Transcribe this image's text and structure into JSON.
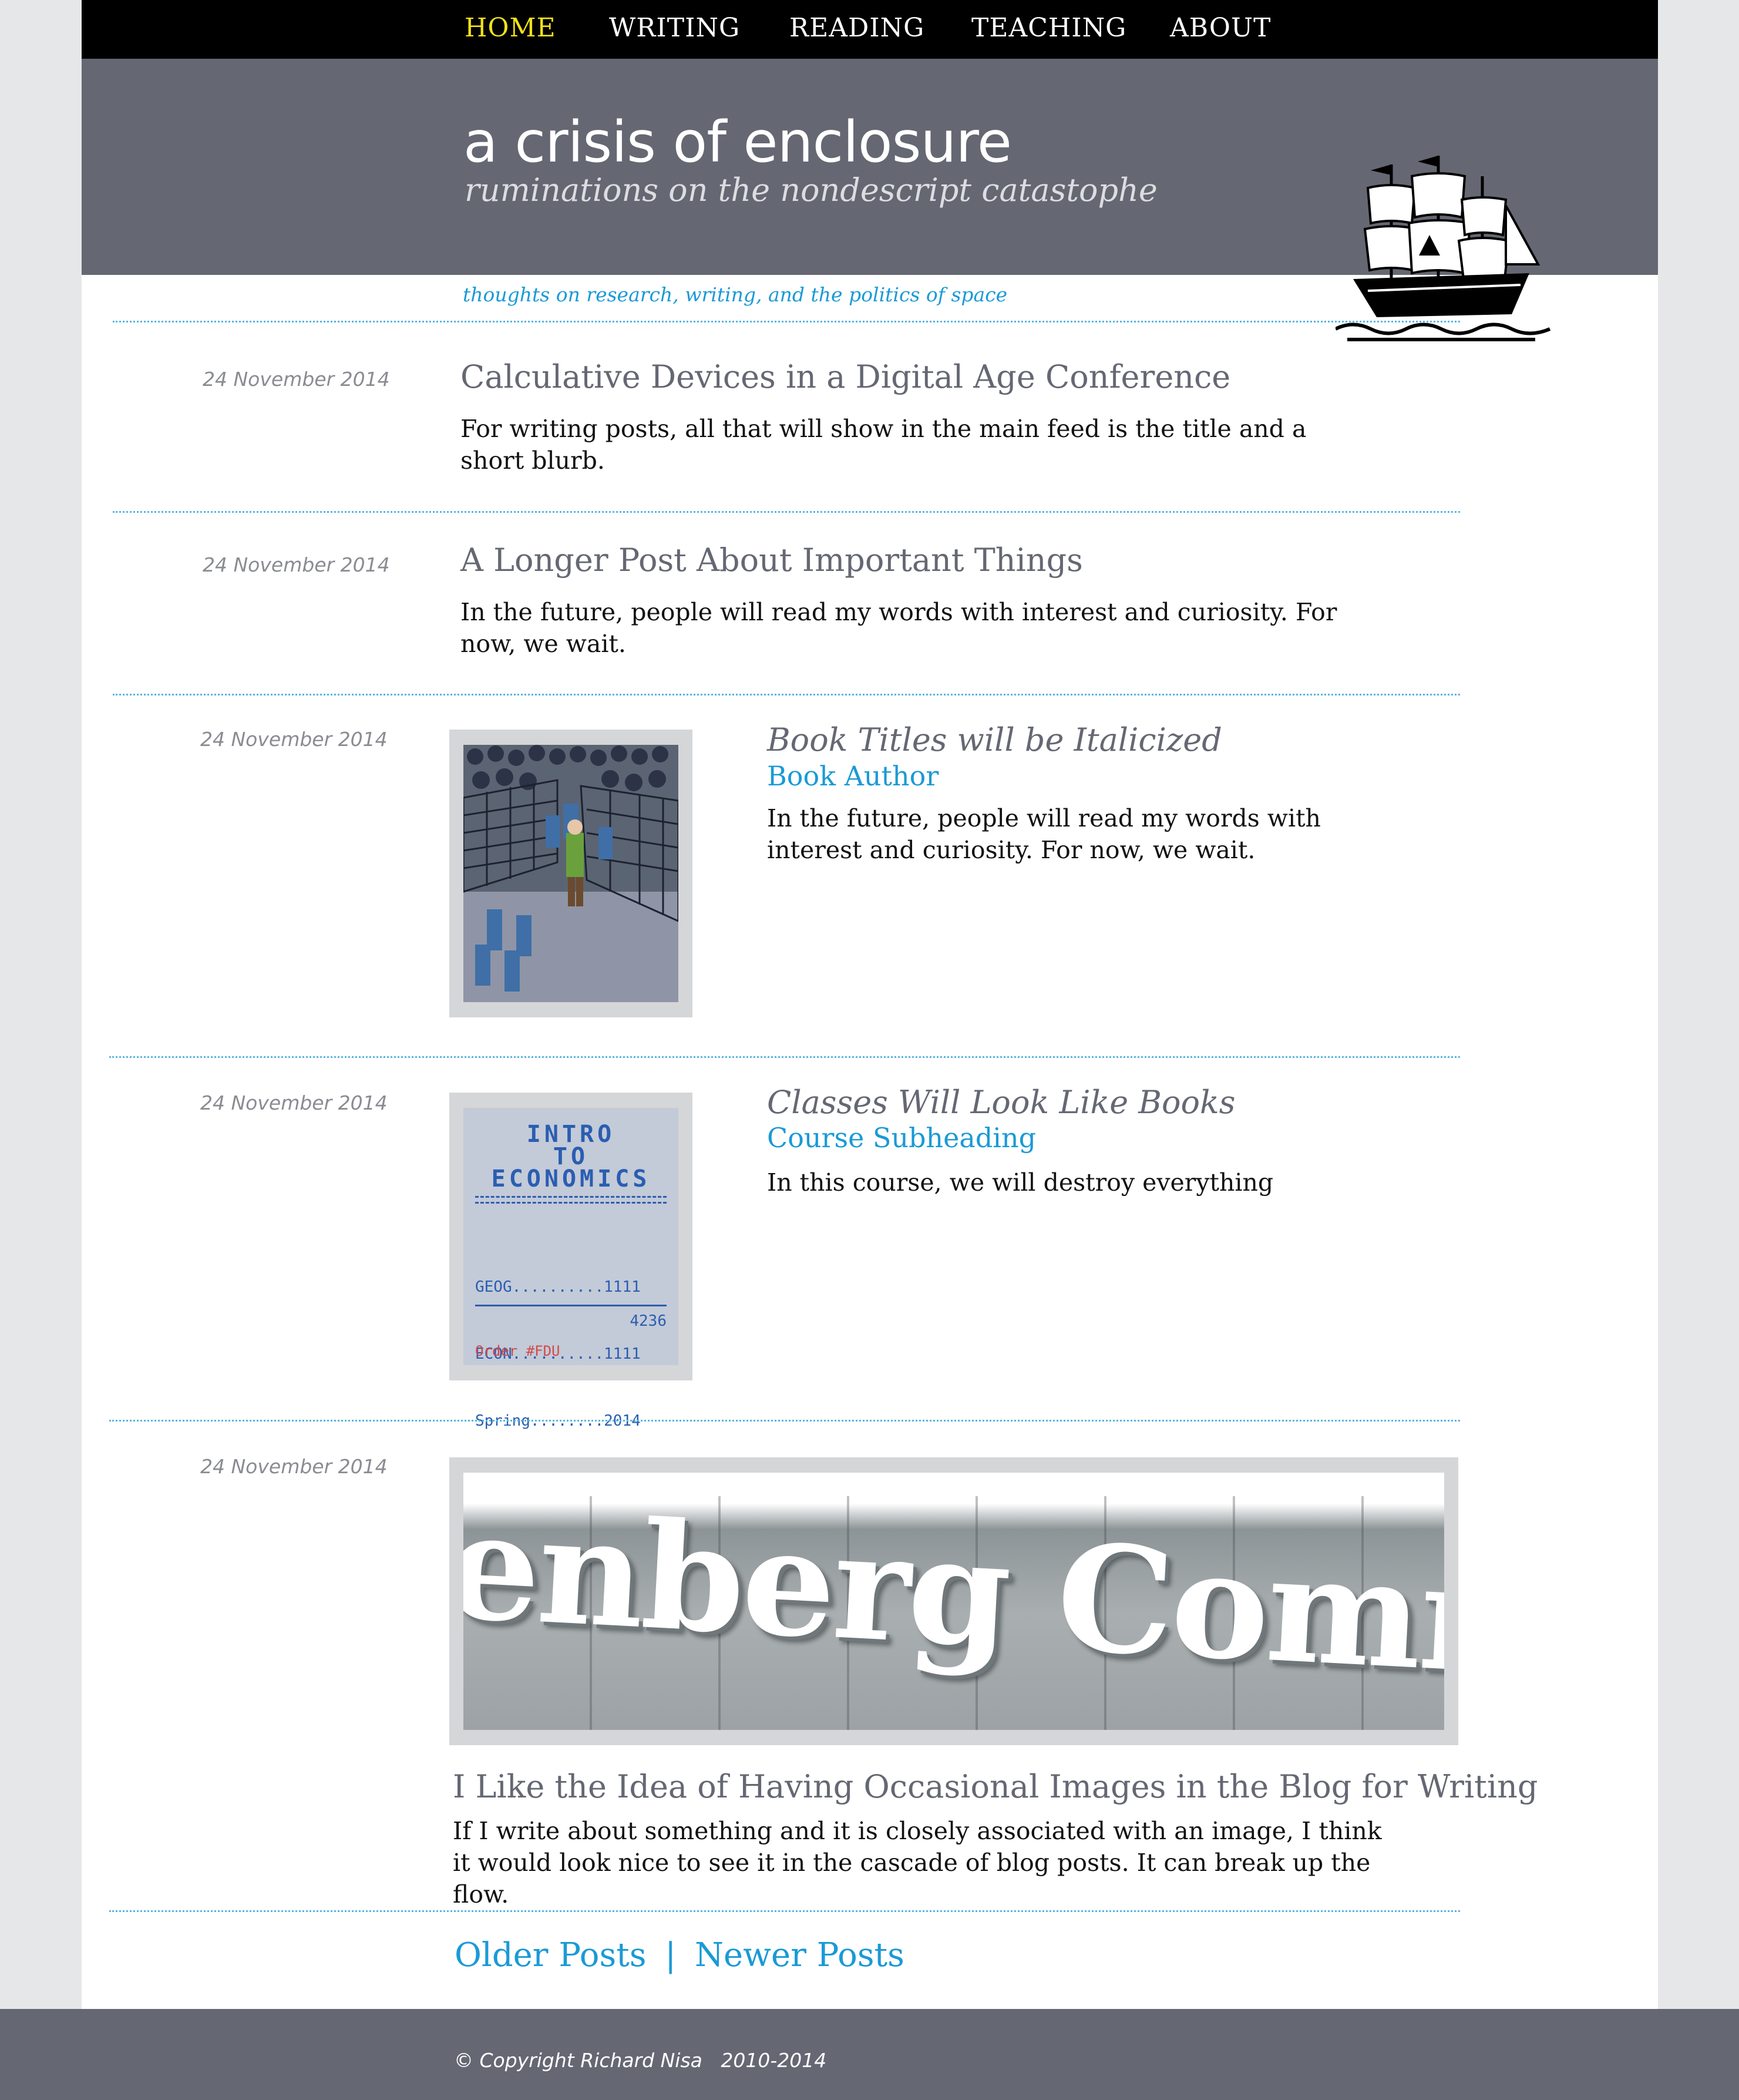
{
  "nav": {
    "items": [
      {
        "label": "HOME",
        "active": true
      },
      {
        "label": "WRITING",
        "active": false
      },
      {
        "label": "READING",
        "active": false
      },
      {
        "label": "TEACHING",
        "active": false
      },
      {
        "label": "ABOUT",
        "active": false
      }
    ]
  },
  "header": {
    "title": "a crisis of enclosure",
    "subtitle": "ruminations on the nondescript catastophe",
    "logo_icon": "ship-icon",
    "tagline": "thoughts on research, writing, and the politics of space"
  },
  "posts": [
    {
      "date": "24 November 2014",
      "title": "Calculative Devices in a Digital Age Conference",
      "body": "For writing posts, all that will show in the main feed is the title and a short blurb."
    },
    {
      "date": "24 November 2014",
      "title": "A Longer Post About Important Things",
      "body": "In the future, people will read my words with interest and curiosity. For now, we wait."
    },
    {
      "date": "24 November 2014",
      "title": "Book Titles will be Italicized",
      "subheading": "Book Author",
      "body": "In the future, people will read my words with interest and curiosity. For now, we wait."
    },
    {
      "date": "24 November 2014",
      "title": "Classes Will Look Like Books",
      "subheading": "Course Subheading",
      "body": "In this course, we will destroy everything",
      "cover": {
        "line1": "INTRO",
        "line2": "TO",
        "line3": "ECONOMICS",
        "rows": [
          "GEOG..........1111",
          "ECON..........1111",
          "Spring........2014"
        ],
        "number": "4236",
        "order": "Order #FDU"
      }
    },
    {
      "date": "24 November 2014",
      "title": "I Like the Idea of Having Occasional Images in the Blog for Writing",
      "body": "If I write about something and it is closely associated with an image, I think it would look nice to see it in the cascade of blog posts. It can break up the flow.",
      "banner_text": "enberg Community"
    }
  ],
  "pager": {
    "older": "Older Posts",
    "separator": "|",
    "newer": "Newer Posts"
  },
  "footer": {
    "copyright": "© Copyright Richard Nisa   2010-2014"
  }
}
